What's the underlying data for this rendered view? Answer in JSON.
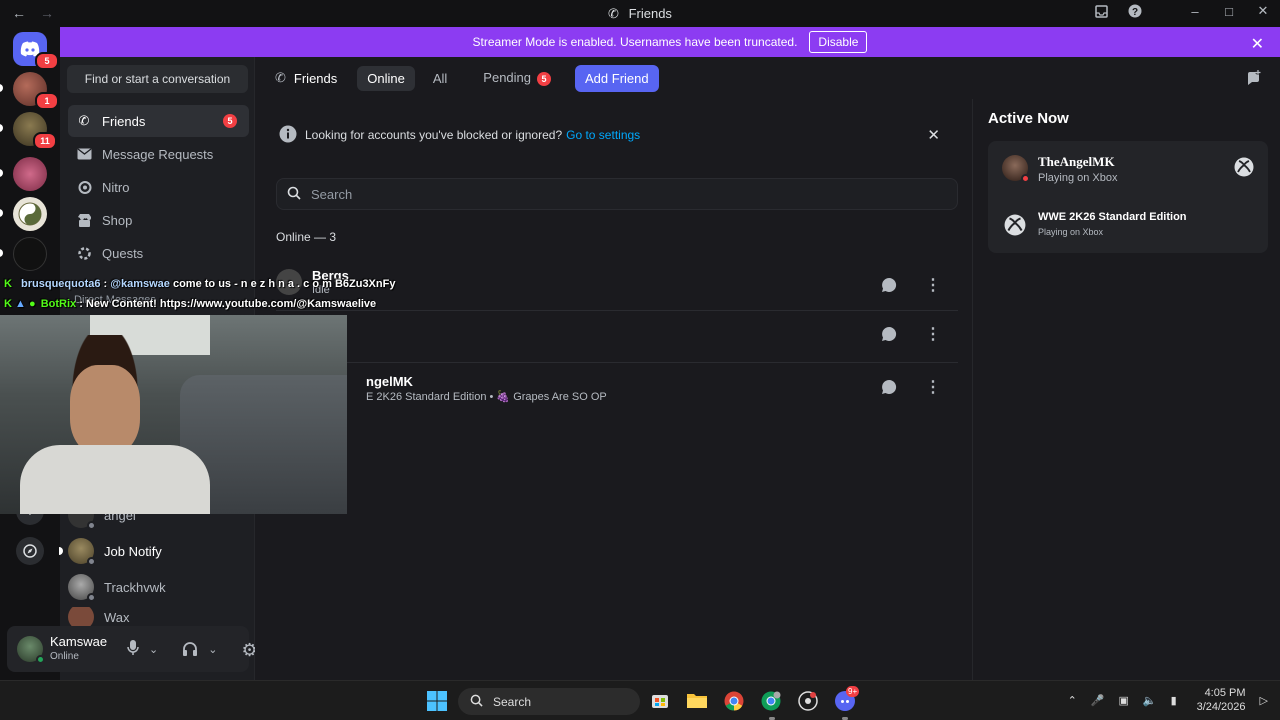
{
  "window": {
    "title": "Friends"
  },
  "banner": {
    "text": "Streamer Mode is enabled. Usernames have been truncated.",
    "button": "Disable"
  },
  "guild_badges": {
    "home": "5",
    "dm1": "1",
    "dm2": "11"
  },
  "sidebar": {
    "search_placeholder": "Find or start a conversation",
    "items": [
      {
        "label": "Friends",
        "badge": "5"
      },
      {
        "label": "Message Requests"
      },
      {
        "label": "Nitro"
      },
      {
        "label": "Shop"
      },
      {
        "label": "Quests"
      }
    ],
    "dm_header": "Direct Messages",
    "dms": [
      {
        "name": "angel"
      },
      {
        "name": "Job Notify"
      },
      {
        "name": "Trackhvwk"
      },
      {
        "name": "Wax"
      }
    ]
  },
  "user": {
    "name": "Kamswae",
    "status": "Online"
  },
  "topbar": {
    "title": "Friends",
    "tabs": [
      {
        "label": "Online"
      },
      {
        "label": "All"
      },
      {
        "label": "Pending",
        "badge": "5"
      }
    ],
    "add_friend": "Add Friend"
  },
  "notice": {
    "text": "Looking for accounts you've blocked or ignored?",
    "link": "Go to settings"
  },
  "search": {
    "placeholder": "Search"
  },
  "online": {
    "header": "Online — 3",
    "friends": [
      {
        "name": "Bergs",
        "sub": "Idle"
      },
      {
        "name": "",
        "sub": ""
      },
      {
        "name": "ngelMK",
        "sub": "E 2K26 Standard Edition • 🍇 Grapes Are SO OP"
      }
    ]
  },
  "active_now": {
    "title": "Active Now",
    "user": "TheAngelMK",
    "user_sub": "Playing on Xbox",
    "game": "WWE 2K26 Standard Edition",
    "game_sub": "Playing on Xbox"
  },
  "chat_overlay": {
    "line1_user": "brusquequota6",
    "line1_mention": "@kamswae",
    "line1_text": "come to us - n e z h n a . c o m B6Zu3XnFy",
    "line2_user": "BotRix",
    "line2_text": "New Content! https://www.youtube.com/@Kamswaelive"
  },
  "taskbar": {
    "search": "Search",
    "time": "4:05 PM",
    "date": "3/24/2026",
    "discord_badge": "9+"
  }
}
